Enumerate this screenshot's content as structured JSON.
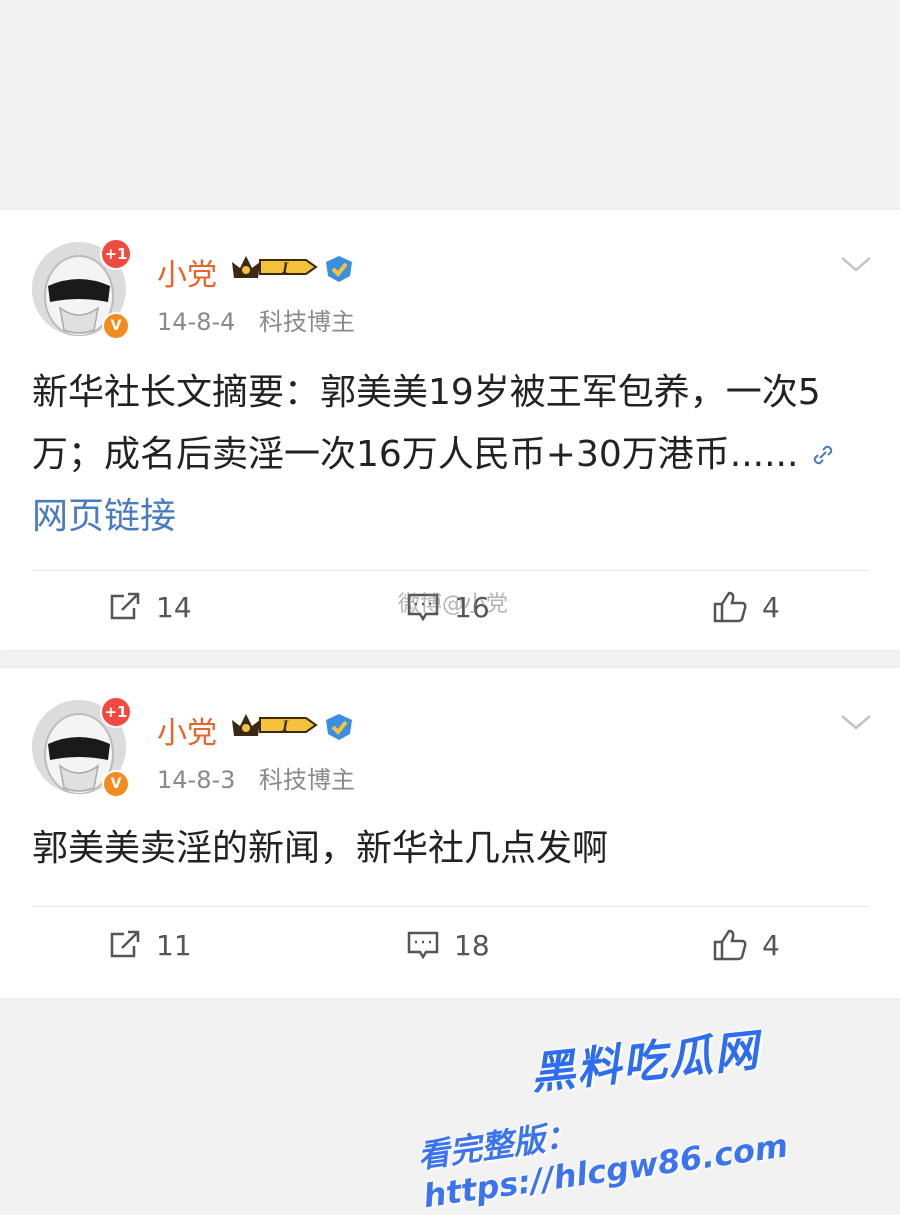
{
  "watermark": {
    "middle": "微博@小党",
    "brand": "黑料吃瓜网",
    "url": "看完整版：https://hlcgw86.com"
  },
  "posts": [
    {
      "username": "小党",
      "vip_level": "I",
      "avatar_badge": "+1",
      "verified_badge": "V",
      "time": "14-8-4",
      "category": "科技博主",
      "text_parts": [
        "新华社长文摘要：郭美美19岁被王军包养，一次5万；成名后卖淫一次16万人民币+30万港币......"
      ],
      "link_label": "网页链接",
      "reposts": "14",
      "comments": "16",
      "likes": "4"
    },
    {
      "username": "小党",
      "vip_level": "I",
      "avatar_badge": "+1",
      "verified_badge": "V",
      "time": "14-8-3",
      "category": "科技博主",
      "text_parts": [
        "郭美美卖淫的新闻，新华社几点发啊"
      ],
      "link_label": "",
      "reposts": "11",
      "comments": "18",
      "likes": "4"
    }
  ],
  "colors": {
    "username": "#e8652a",
    "link": "#4a7bc1",
    "badge_red": "#f24a3f",
    "badge_orange": "#f38b1e",
    "verify_blue": "#3a8fe0",
    "watermark_blue": "#2f6df0"
  },
  "icons": [
    "repost-icon",
    "comment-icon",
    "like-icon",
    "chevron-down-icon",
    "link-icon",
    "crown-icon",
    "verified-icon"
  ]
}
